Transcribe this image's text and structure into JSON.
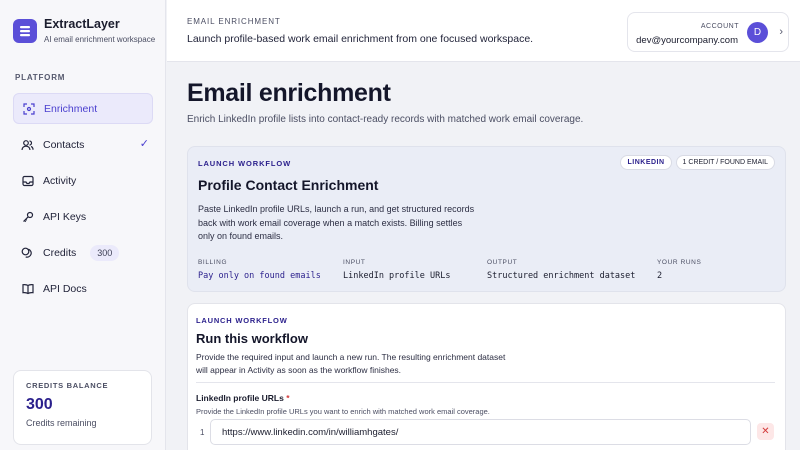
{
  "brand": {
    "name": "ExtractLayer",
    "tagline": "AI email enrichment workspace",
    "logo_icon": "stack-icon",
    "accent": "#5b4fd8"
  },
  "sidebar": {
    "heading": "PLATFORM",
    "items": [
      {
        "label": "Enrichment",
        "icon": "scan-icon",
        "active": true
      },
      {
        "label": "Contacts",
        "icon": "users-icon",
        "checked": true
      },
      {
        "label": "Activity",
        "icon": "inbox-icon"
      },
      {
        "label": "API Keys",
        "icon": "key-icon"
      },
      {
        "label": "Credits",
        "icon": "coins-icon",
        "badge": "300"
      },
      {
        "label": "API Docs",
        "icon": "book-icon"
      }
    ],
    "credits_card": {
      "label": "CREDITS BALANCE",
      "value": "300",
      "sub": "Credits remaining"
    }
  },
  "header": {
    "overline": "EMAIL ENRICHMENT",
    "title": "Launch profile-based work email enrichment from one focused workspace.",
    "account": {
      "label": "ACCOUNT",
      "email": "dev@yourcompany.com",
      "avatar": "D"
    }
  },
  "main": {
    "title": "Email enrichment",
    "subtitle": "Enrich LinkedIn profile lists into contact-ready records with matched work email coverage.",
    "workflow_card": {
      "overline": "LAUNCH WORKFLOW",
      "pills": [
        "LINKEDIN",
        "1 CREDIT / FOUND EMAIL"
      ],
      "title": "Profile Contact Enrichment",
      "description": "Paste LinkedIn profile URLs, launch a run, and get structured records back with work email coverage when a match exists. Billing settles only on found emails.",
      "meta": [
        {
          "label": "BILLING",
          "value": "Pay only on found emails"
        },
        {
          "label": "INPUT",
          "value": "LinkedIn profile URLs"
        },
        {
          "label": "OUTPUT",
          "value": "Structured enrichment dataset"
        },
        {
          "label": "YOUR RUNS",
          "value": "2"
        }
      ]
    },
    "run_card": {
      "overline": "LAUNCH WORKFLOW",
      "title": "Run this workflow",
      "description": "Provide the required input and launch a new run. The resulting enrichment dataset will appear in Activity as soon as the workflow finishes.",
      "field_label": "LinkedIn profile URLs",
      "required_mark": "*",
      "field_help": "Provide the LinkedIn profile URLs you want to enrich with matched work email coverage.",
      "rows": [
        {
          "index": "1",
          "value": "https://www.linkedin.com/in/williamhgates/"
        }
      ],
      "remove_glyph": "✕"
    }
  }
}
